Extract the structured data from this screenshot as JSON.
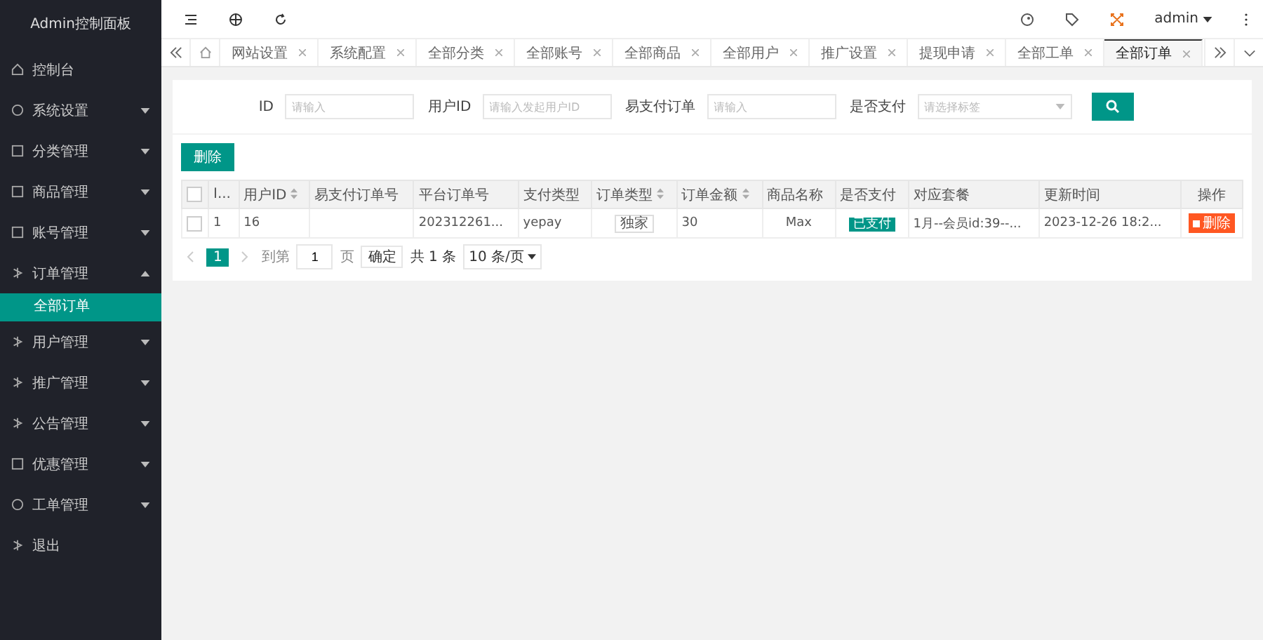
{
  "sidebar": {
    "title": "Admin控制面板",
    "items": [
      {
        "label": "控制台"
      },
      {
        "label": "系统设置",
        "expanded": false
      },
      {
        "label": "分类管理",
        "expanded": false
      },
      {
        "label": "商品管理",
        "expanded": false
      },
      {
        "label": "账号管理",
        "expanded": false
      },
      {
        "label": "订单管理",
        "expanded": true,
        "children": [
          {
            "label": "全部订单",
            "selected": true
          }
        ]
      },
      {
        "label": "用户管理",
        "expanded": false
      },
      {
        "label": "推广管理",
        "expanded": false
      },
      {
        "label": "公告管理",
        "expanded": false
      },
      {
        "label": "优惠管理",
        "expanded": false
      },
      {
        "label": "工单管理",
        "expanded": false
      },
      {
        "label": "退出"
      }
    ]
  },
  "header": {
    "user": "admin"
  },
  "tabs": [
    {
      "label": "网站设置",
      "selected": false
    },
    {
      "label": "系统配置",
      "selected": false
    },
    {
      "label": "全部分类",
      "selected": false
    },
    {
      "label": "全部账号",
      "selected": false
    },
    {
      "label": "全部商品",
      "selected": false
    },
    {
      "label": "全部用户",
      "selected": false
    },
    {
      "label": "推广设置",
      "selected": false
    },
    {
      "label": "提现申请",
      "selected": false
    },
    {
      "label": "全部工单",
      "selected": false
    },
    {
      "label": "全部订单",
      "selected": true
    }
  ],
  "filters": [
    {
      "kind": "input",
      "label": "ID",
      "placeholder": "请输入"
    },
    {
      "kind": "input",
      "label": "用户ID",
      "placeholder": "请输入发起用户ID"
    },
    {
      "kind": "input",
      "label": "易支付订单",
      "placeholder": "请输入"
    },
    {
      "kind": "select",
      "label": "是否支付",
      "placeholder": "请选择标签"
    }
  ],
  "delete_button": "删除",
  "table": {
    "all_checked": false,
    "columns": [
      {
        "label": "I...",
        "sortable": false
      },
      {
        "label": "用户ID",
        "sortable": true
      },
      {
        "label": "易支付订单号",
        "sortable": false
      },
      {
        "label": "平台订单号",
        "sortable": false
      },
      {
        "label": "支付类型",
        "sortable": false
      },
      {
        "label": "订单类型",
        "sortable": true
      },
      {
        "label": "订单金额",
        "sortable": true
      },
      {
        "label": "商品名称",
        "sortable": false
      },
      {
        "label": "是否支付",
        "sortable": false
      },
      {
        "label": "对应套餐",
        "sortable": false
      },
      {
        "label": "更新时间",
        "sortable": false
      },
      {
        "label": "操作",
        "sortable": false
      }
    ],
    "rows": [
      {
        "checked": false,
        "cells": [
          {
            "kind": "text",
            "text": "1"
          },
          {
            "kind": "text",
            "text": "16"
          },
          {
            "kind": "empty"
          },
          {
            "kind": "text",
            "text": "202312261..."
          },
          {
            "kind": "text",
            "text": "yepay"
          },
          {
            "kind": "tag",
            "text": "独家"
          },
          {
            "kind": "text",
            "text": "30"
          },
          {
            "kind": "center",
            "text": "Max"
          },
          {
            "kind": "status",
            "text": "已支付"
          },
          {
            "kind": "text",
            "text": "1月--会员id:39--..."
          },
          {
            "kind": "text",
            "text": "2023-12-26 18:2..."
          },
          {
            "kind": "action",
            "text": "删除"
          }
        ]
      }
    ]
  },
  "pagination": {
    "current": "1",
    "goto_label": "到第",
    "goto_value": "1",
    "page_unit": "页",
    "confirm": "确定",
    "total": "共 1 条",
    "page_size": "10 条/页"
  }
}
